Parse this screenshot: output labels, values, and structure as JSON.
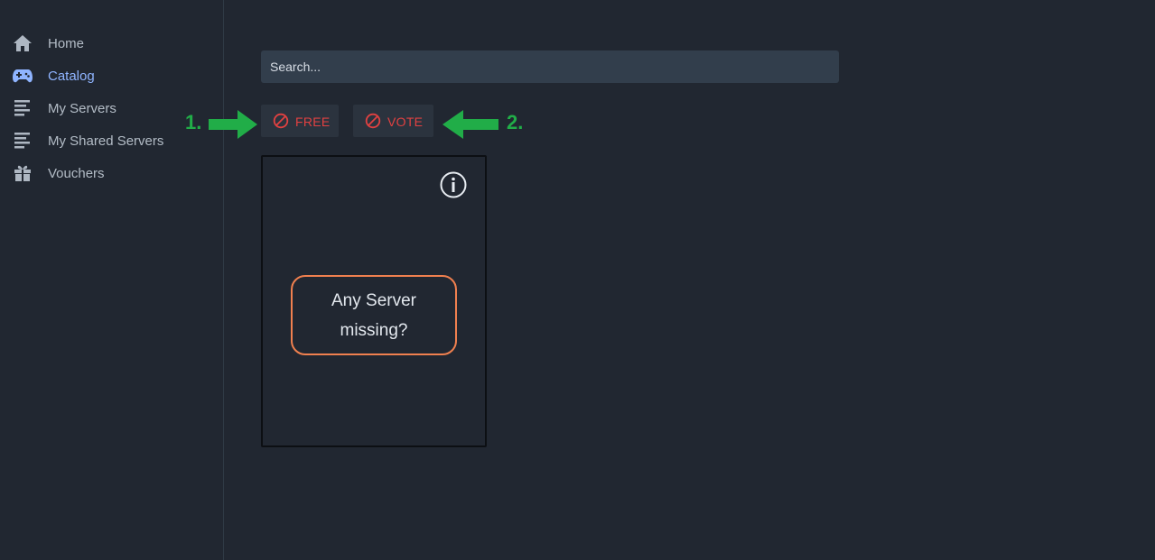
{
  "sidebar": {
    "items": [
      {
        "label": "Home",
        "icon": "home-icon",
        "active": false
      },
      {
        "label": "Catalog",
        "icon": "gamepad-icon",
        "active": true
      },
      {
        "label": "My Servers",
        "icon": "server-list-icon",
        "active": false
      },
      {
        "label": "My Shared Servers",
        "icon": "server-list-icon",
        "active": false
      },
      {
        "label": "Vouchers",
        "icon": "gift-icon",
        "active": false
      }
    ]
  },
  "search": {
    "placeholder": "Search..."
  },
  "filters": {
    "free_label": "FREE",
    "vote_label": "VOTE",
    "icon": "ban-icon"
  },
  "annotations": {
    "first": "1.",
    "second": "2.",
    "color": "#21ad48"
  },
  "card": {
    "info_icon": "info-icon",
    "missing_label": "Any Server missing?",
    "border_accent": "#f0804f"
  },
  "colors": {
    "background": "#212731",
    "active_link": "#8fb4ff",
    "filter_text": "#e24141"
  }
}
